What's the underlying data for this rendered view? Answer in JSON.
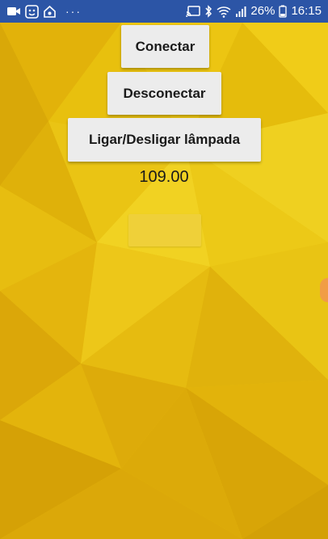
{
  "status_bar": {
    "left_icons": [
      "video-camera-icon",
      "face-emoji-icon",
      "smart-home-icon"
    ],
    "more_label": "···",
    "right_icons": [
      "cast-icon",
      "bluetooth-icon",
      "wifi-icon",
      "signal-bars-icon",
      "battery-icon"
    ],
    "battery_percent": "26%",
    "time": "16:15",
    "background_color": "#2c55a6"
  },
  "main": {
    "buttons": {
      "connect_label": "Conectar",
      "disconnect_label": "Desconectar",
      "toggle_lamp_label": "Ligar/Desligar lâmpada"
    },
    "reading_value": "109.00",
    "indicator_color": "#efd039"
  },
  "theme": {
    "background_color": "#e7bd0b",
    "button_color": "#ececec",
    "text_color": "#1a1a1a"
  }
}
